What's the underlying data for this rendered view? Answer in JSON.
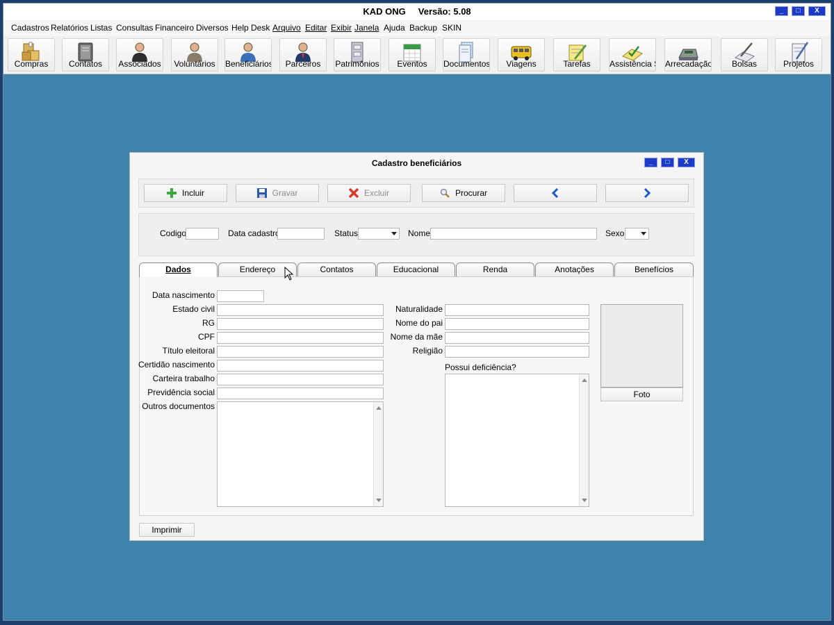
{
  "app": {
    "title": "KAD ONG     Versão: 5.08",
    "window_controls": {
      "minimize": "_",
      "maximize": "□",
      "close": "X"
    }
  },
  "menu": [
    "Cadastros",
    "Relatórios",
    "Listas",
    "Consultas",
    "Financeiro",
    "Diversos",
    "Help Desk",
    "Arquivo",
    "Editar",
    "Exibir",
    "Janela",
    "Ajuda",
    "Backup",
    "SKIN"
  ],
  "toolbar": [
    {
      "label": "Compras",
      "icon": "boxes-icon"
    },
    {
      "label": "Contatos",
      "icon": "address-book-icon"
    },
    {
      "label": "Associados",
      "icon": "person-dark-icon"
    },
    {
      "label": "Voluntários",
      "icon": "person-icon"
    },
    {
      "label": "Beneficiários",
      "icon": "person-blue-icon"
    },
    {
      "label": "Parceiros",
      "icon": "person-suit-icon"
    },
    {
      "label": "Patrimônios",
      "icon": "cabinet-icon"
    },
    {
      "label": "Eventos",
      "icon": "calendar-icon"
    },
    {
      "label": "Documentos",
      "icon": "documents-icon"
    },
    {
      "label": "Viagens",
      "icon": "bus-icon"
    },
    {
      "label": "Tarefas",
      "icon": "notepad-pencil-icon"
    },
    {
      "label": "Assistência S",
      "icon": "checklist-icon"
    },
    {
      "label": "Arrecadação",
      "icon": "cash-register-icon"
    },
    {
      "label": "Bolsas",
      "icon": "pen-paper-icon"
    },
    {
      "label": "Projetos",
      "icon": "project-paper-icon"
    }
  ],
  "dialog": {
    "title": "Cadastro beneficiários",
    "actions": {
      "incluir": "Incluir",
      "gravar": "Gravar",
      "excluir": "Excluir",
      "procurar": "Procurar"
    },
    "header_fields": {
      "codigo": "Codigo",
      "data_cadastro": "Data cadastro",
      "status": "Status",
      "nome": "Nome",
      "sexo": "Sexo"
    },
    "tabs": [
      "Dados",
      "Endereço",
      "Contatos",
      "Educacional",
      "Renda",
      "Anotações",
      "Benefícios"
    ],
    "left_labels": [
      "Data nascimento",
      "Estado civil",
      "RG",
      "CPF",
      "Título eleitoral",
      "Certidão nascimento",
      "Carteira trabalho",
      "Previdência social",
      "Outros documentos"
    ],
    "right_labels": [
      "Naturalidade",
      "Nome do pai",
      "Nome da mãe",
      "Religião"
    ],
    "deficiencia_label": "Possui deficiência?",
    "photo_button": "Foto",
    "print_button": "Imprimir"
  },
  "colors": {
    "accent": "#1c3cc8",
    "desktop": "#3f83ad",
    "frame": "#1c3f6e"
  }
}
